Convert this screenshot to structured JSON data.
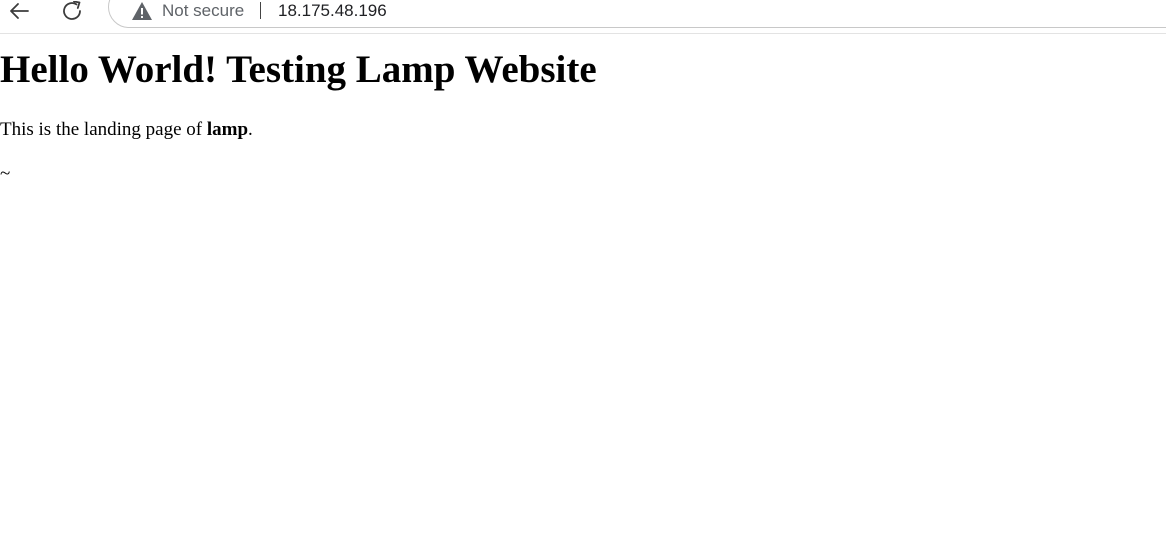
{
  "browser": {
    "security_label": "Not secure",
    "url": "18.175.48.196",
    "icons": {
      "back": "back-arrow-icon",
      "reload": "reload-icon",
      "security": "warning-icon"
    }
  },
  "page": {
    "heading": "Hello World! Testing Lamp Website",
    "paragraph_prefix": "This is the landing page of ",
    "paragraph_bold": "lamp",
    "paragraph_suffix": ".",
    "tilde": "~"
  }
}
